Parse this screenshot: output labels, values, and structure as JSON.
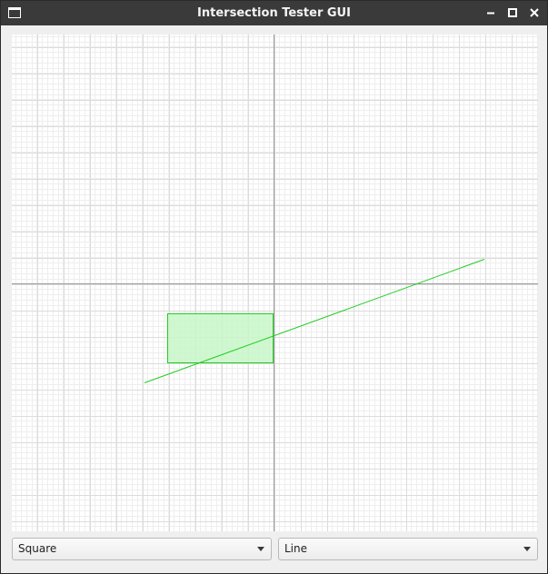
{
  "window": {
    "title": "Intersection Tester GUI",
    "controls": {
      "minimize_icon": "minimize-icon",
      "maximize_icon": "maximize-icon",
      "close_icon": "close-icon"
    },
    "app_icon": "window-icon"
  },
  "canvas": {
    "grid": true,
    "axes": true,
    "colors": {
      "minor_grid": "#eeeeee",
      "major_grid": "#dcdcdc",
      "axis": "#9a9a9a",
      "shape_stroke": "#22cc22",
      "shape_fill": "#c8f7c8"
    },
    "shapes": [
      {
        "kind": "rectangle",
        "name": "Square"
      },
      {
        "kind": "line",
        "name": "Line"
      }
    ]
  },
  "controls": {
    "shape_a": {
      "selected": "Square"
    },
    "shape_b": {
      "selected": "Line"
    }
  }
}
